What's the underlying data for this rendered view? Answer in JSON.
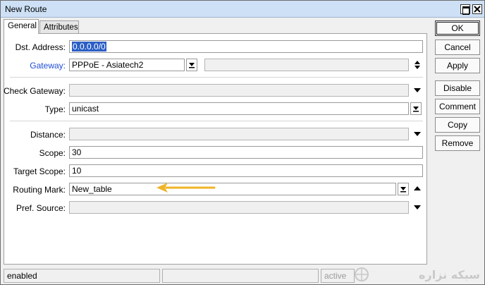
{
  "window": {
    "title": "New Route"
  },
  "tabs": [
    {
      "label": "General",
      "active": true
    },
    {
      "label": "Attributes",
      "active": false
    }
  ],
  "form": {
    "dst_address": {
      "label": "Dst. Address:",
      "value": "0.0.0.0/0"
    },
    "gateway": {
      "label": "Gateway:",
      "value": "PPPoE - Asiatech2",
      "secondary_value": ""
    },
    "check_gateway": {
      "label": "Check Gateway:",
      "value": ""
    },
    "type": {
      "label": "Type:",
      "value": "unicast"
    },
    "distance": {
      "label": "Distance:",
      "value": ""
    },
    "scope": {
      "label": "Scope:",
      "value": "30"
    },
    "target_scope": {
      "label": "Target Scope:",
      "value": "10"
    },
    "routing_mark": {
      "label": "Routing Mark:",
      "value": "New_table"
    },
    "pref_source": {
      "label": "Pref. Source:",
      "value": ""
    }
  },
  "buttons": {
    "ok": "OK",
    "cancel": "Cancel",
    "apply": "Apply",
    "disable": "Disable",
    "comment": "Comment",
    "copy": "Copy",
    "remove": "Remove"
  },
  "status": {
    "state": "enabled",
    "middle": "",
    "activity": "active"
  },
  "watermark": {
    "text": "سبکه نزاره"
  },
  "colors": {
    "titlebar": "#cde0f5",
    "gateway_label": "#1f4fd6",
    "selection": "#2b5fc6",
    "annotation_arrow": "#f0b428"
  },
  "icons": {
    "dropdown": "triangle-down-icon",
    "updown": "updown-arrow-icon",
    "annotation": "arrow-left-annotation-icon"
  }
}
